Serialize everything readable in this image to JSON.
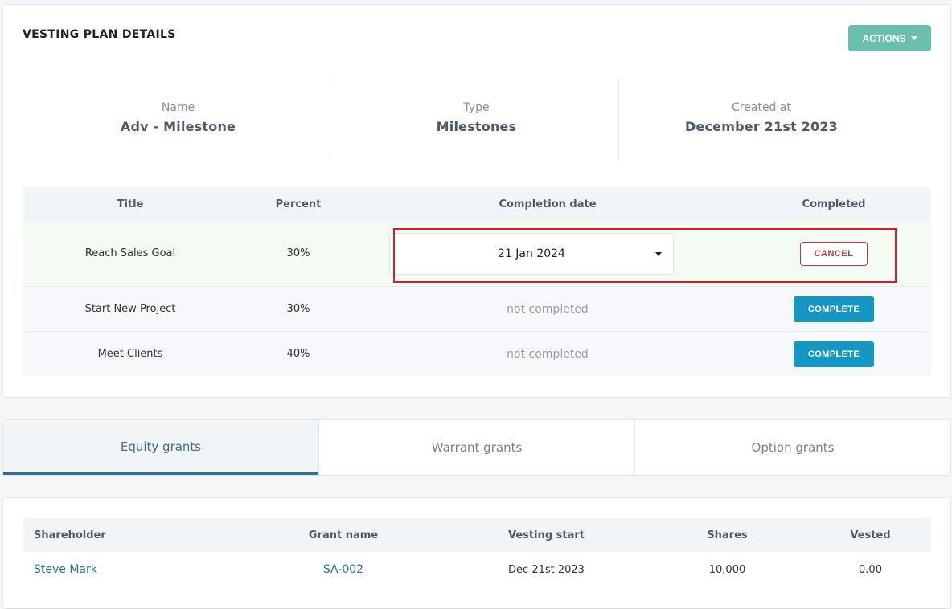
{
  "plan": {
    "title": "VESTING PLAN DETAILS",
    "actions_label": "ACTIONS",
    "info": [
      {
        "label": "Name",
        "value": "Adv - Milestone"
      },
      {
        "label": "Type",
        "value": "Milestones"
      },
      {
        "label": "Created at",
        "value": "December 21st 2023"
      }
    ]
  },
  "milestones": {
    "headers": [
      "Title",
      "Percent",
      "Completion date",
      "Completed"
    ],
    "rows": [
      {
        "title": "Reach Sales Goal",
        "percent": "30%",
        "completion_date": "21 Jan 2024",
        "action": "CANCEL"
      },
      {
        "title": "Start New Project",
        "percent": "30%",
        "completion_date": "not completed",
        "action": "COMPLETE"
      },
      {
        "title": "Meet Clients",
        "percent": "40%",
        "completion_date": "not completed",
        "action": "COMPLETE"
      }
    ]
  },
  "tabs": [
    "Equity grants",
    "Warrant grants",
    "Option grants"
  ],
  "grants": {
    "headers": [
      "Shareholder",
      "Grant name",
      "Vesting start",
      "Shares",
      "Vested"
    ],
    "rows": [
      {
        "shareholder": "Steve Mark",
        "grant_name": "SA-002",
        "vesting_start": "Dec 21st 2023",
        "shares": "10,000",
        "vested": "0.00"
      }
    ]
  },
  "colors": {
    "accent": "#6bbfae",
    "complete": "#1597c6",
    "cancel": "#b53a3a",
    "highlight": "#d21f2b",
    "link": "#2a6f99"
  }
}
